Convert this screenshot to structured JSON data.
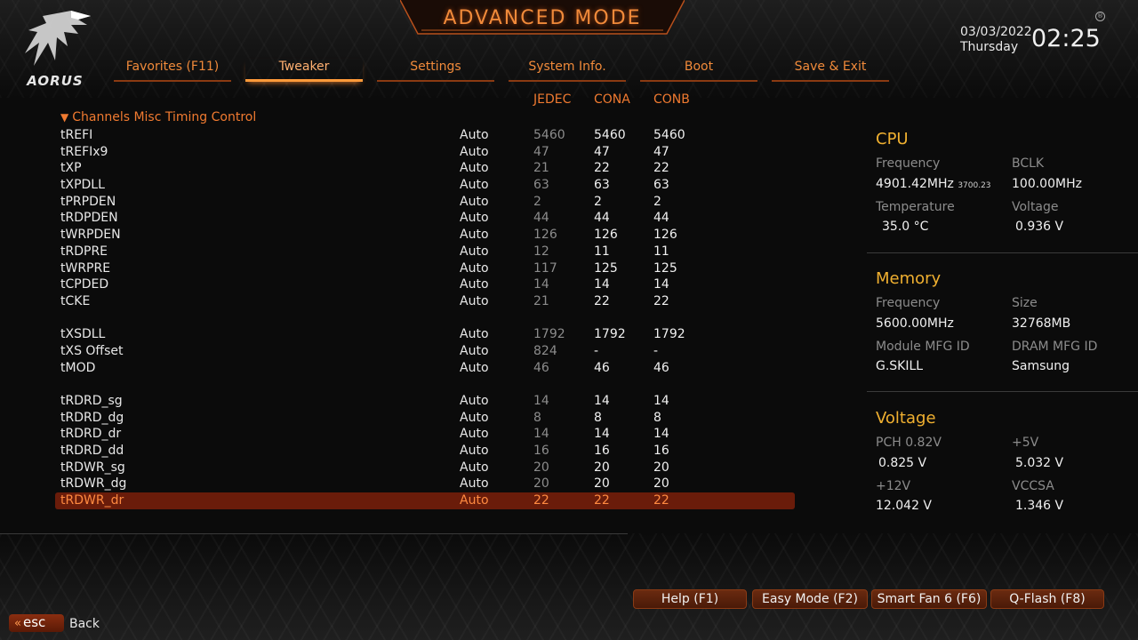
{
  "header": {
    "title": "ADVANCED MODE",
    "brand": "AORUS",
    "date": "03/03/2022",
    "day": "Thursday",
    "time": "02:25"
  },
  "tabs": [
    {
      "label": "Favorites (F11)",
      "active": false
    },
    {
      "label": "Tweaker",
      "active": true
    },
    {
      "label": "Settings",
      "active": false
    },
    {
      "label": "System Info.",
      "active": false
    },
    {
      "label": "Boot",
      "active": false
    },
    {
      "label": "Save & Exit",
      "active": false
    }
  ],
  "columns": {
    "jedec": "JEDEC",
    "cona": "CONA",
    "conb": "CONB"
  },
  "section": {
    "title": "Channels Misc Timing Control"
  },
  "rows": [
    {
      "name": "tREFI",
      "mode": "Auto",
      "jedec": "5460",
      "cona": "5460",
      "conb": "5460"
    },
    {
      "name": "tREFIx9",
      "mode": "Auto",
      "jedec": "47",
      "cona": "47",
      "conb": "47"
    },
    {
      "name": "tXP",
      "mode": "Auto",
      "jedec": "21",
      "cona": "22",
      "conb": "22"
    },
    {
      "name": "tXPDLL",
      "mode": "Auto",
      "jedec": "63",
      "cona": "63",
      "conb": "63"
    },
    {
      "name": "tPRPDEN",
      "mode": "Auto",
      "jedec": "2",
      "cona": "2",
      "conb": "2"
    },
    {
      "name": "tRDPDEN",
      "mode": "Auto",
      "jedec": "44",
      "cona": "44",
      "conb": "44"
    },
    {
      "name": "tWRPDEN",
      "mode": "Auto",
      "jedec": "126",
      "cona": "126",
      "conb": "126"
    },
    {
      "name": "tRDPRE",
      "mode": "Auto",
      "jedec": "12",
      "cona": "11",
      "conb": "11"
    },
    {
      "name": "tWRPRE",
      "mode": "Auto",
      "jedec": "117",
      "cona": "125",
      "conb": "125"
    },
    {
      "name": "tCPDED",
      "mode": "Auto",
      "jedec": "14",
      "cona": "14",
      "conb": "14"
    },
    {
      "name": "tCKE",
      "mode": "Auto",
      "jedec": "21",
      "cona": "22",
      "conb": "22"
    },
    {
      "gap": true
    },
    {
      "name": "tXSDLL",
      "mode": "Auto",
      "jedec": "1792",
      "cona": "1792",
      "conb": "1792"
    },
    {
      "name": "tXS Offset",
      "mode": "Auto",
      "jedec": "824",
      "cona": "-",
      "conb": "-"
    },
    {
      "name": "tMOD",
      "mode": "Auto",
      "jedec": "46",
      "cona": "46",
      "conb": "46"
    },
    {
      "gap": true
    },
    {
      "name": "tRDRD_sg",
      "mode": "Auto",
      "jedec": "14",
      "cona": "14",
      "conb": "14"
    },
    {
      "name": "tRDRD_dg",
      "mode": "Auto",
      "jedec": "8",
      "cona": "8",
      "conb": "8"
    },
    {
      "name": "tRDRD_dr",
      "mode": "Auto",
      "jedec": "14",
      "cona": "14",
      "conb": "14"
    },
    {
      "name": "tRDRD_dd",
      "mode": "Auto",
      "jedec": "16",
      "cona": "16",
      "conb": "16"
    },
    {
      "name": "tRDWR_sg",
      "mode": "Auto",
      "jedec": "20",
      "cona": "20",
      "conb": "20"
    },
    {
      "name": "tRDWR_dg",
      "mode": "Auto",
      "jedec": "20",
      "cona": "20",
      "conb": "20"
    },
    {
      "name": "tRDWR_dr",
      "mode": "Auto",
      "jedec": "22",
      "cona": "22",
      "conb": "22",
      "selected": true
    }
  ],
  "cpu": {
    "title": "CPU",
    "freq_label": "Frequency",
    "freq_value": "4901.42MHz",
    "freq_sub": "3700.23",
    "bclk_label": "BCLK",
    "bclk_value": "100.00MHz",
    "temp_label": "Temperature",
    "temp_value": "35.0 °C",
    "volt_label": "Voltage",
    "volt_value": "0.936 V"
  },
  "memory": {
    "title": "Memory",
    "freq_label": "Frequency",
    "freq_value": "5600.00MHz",
    "size_label": "Size",
    "size_value": "32768MB",
    "module_label": "Module MFG ID",
    "module_value": "G.SKILL",
    "dram_label": "DRAM MFG ID",
    "dram_value": "Samsung"
  },
  "voltage": {
    "title": "Voltage",
    "pch_label": "PCH 0.82V",
    "pch_value": "0.825 V",
    "p5_label": "+5V",
    "p5_value": "5.032 V",
    "p12_label": "+12V",
    "p12_value": "12.042 V",
    "vccsa_label": "VCCSA",
    "vccsa_value": "1.346 V"
  },
  "footer": {
    "help": "Help (F1)",
    "easy": "Easy Mode (F2)",
    "smartfan": "Smart Fan 6 (F6)",
    "qflash": "Q-Flash (F8)",
    "esc": "esc",
    "back": "Back"
  }
}
